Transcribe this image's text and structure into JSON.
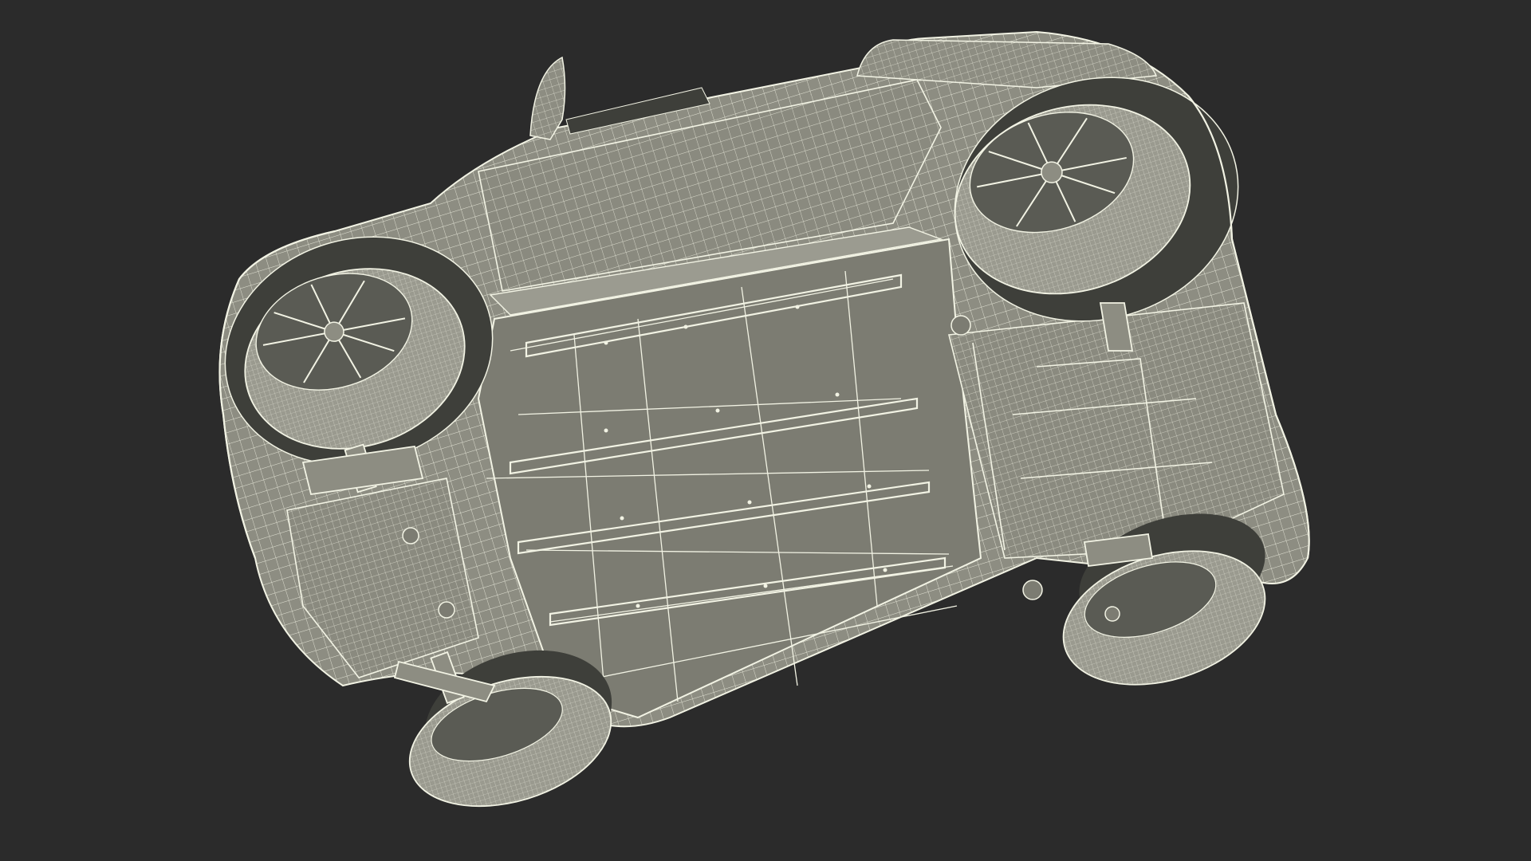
{
  "scene": {
    "background": "#2b2b2b",
    "body_fill": "#8d8d82",
    "panel_fill": "#7c7c72",
    "dark_fill": "#3e3f3a",
    "wire_color": "#f2f3e4",
    "tire_fill": "#9a9a8f",
    "rim_fill": "#5a5b54"
  }
}
